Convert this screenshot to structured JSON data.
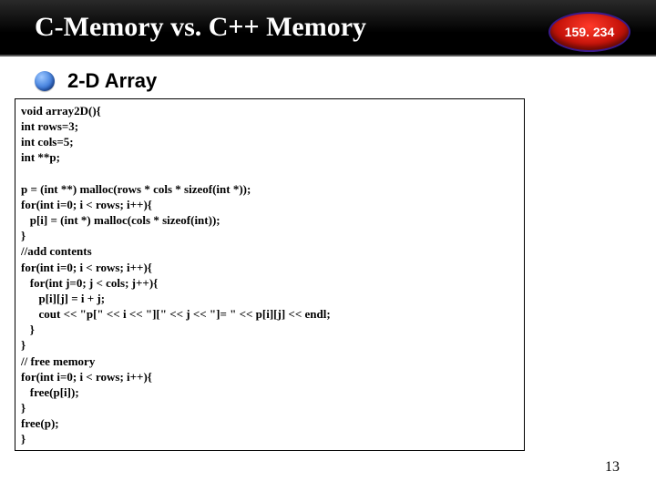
{
  "header": {
    "title": "C-Memory vs. C++ Memory",
    "badge": "159. 234"
  },
  "section": {
    "title": "2-D Array"
  },
  "code": "void array2D(){\nint rows=3;\nint cols=5;\nint **p;\n\np = (int **) malloc(rows * cols * sizeof(int *));\nfor(int i=0; i < rows; i++){\n   p[i] = (int *) malloc(cols * sizeof(int));\n}\n//add contents\nfor(int i=0; i < rows; i++){\n   for(int j=0; j < cols; j++){\n      p[i][j] = i + j;\n      cout << \"p[\" << i << \"][\" << j << \"]= \" << p[i][j] << endl;\n   }\n}\n// free memory\nfor(int i=0; i < rows; i++){\n   free(p[i]);\n}\nfree(p);\n}",
  "page_number": "13"
}
